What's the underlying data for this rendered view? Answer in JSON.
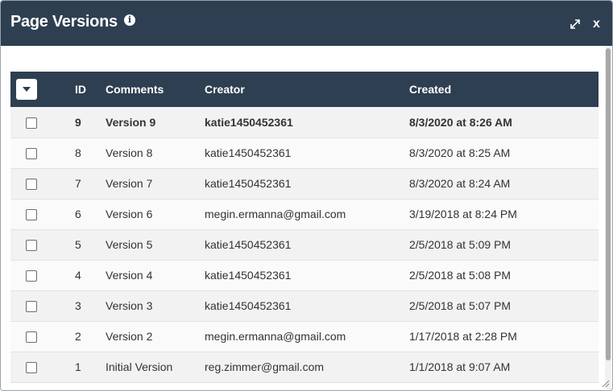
{
  "dialog": {
    "title": "Page Versions",
    "info_icon": "info-icon",
    "expand_icon": "expand-icon",
    "close_label": "x"
  },
  "colors": {
    "header_bg": "#2e3f51",
    "row_odd": "#f2f2f2",
    "row_even": "#fafafa",
    "text": "#333333"
  },
  "table": {
    "headers": {
      "id": "ID",
      "comments": "Comments",
      "creator": "Creator",
      "created": "Created"
    },
    "rows": [
      {
        "id": "9",
        "comments": "Version 9",
        "creator": "katie1450452361",
        "created": "8/3/2020 at 8:26 AM",
        "current": true
      },
      {
        "id": "8",
        "comments": "Version 8",
        "creator": "katie1450452361",
        "created": "8/3/2020 at 8:25 AM",
        "current": false
      },
      {
        "id": "7",
        "comments": "Version 7",
        "creator": "katie1450452361",
        "created": "8/3/2020 at 8:24 AM",
        "current": false
      },
      {
        "id": "6",
        "comments": "Version 6",
        "creator": "megin.ermanna@gmail.com",
        "created": "3/19/2018 at 8:24 PM",
        "current": false
      },
      {
        "id": "5",
        "comments": "Version 5",
        "creator": "katie1450452361",
        "created": "2/5/2018 at 5:09 PM",
        "current": false
      },
      {
        "id": "4",
        "comments": "Version 4",
        "creator": "katie1450452361",
        "created": "2/5/2018 at 5:08 PM",
        "current": false
      },
      {
        "id": "3",
        "comments": "Version 3",
        "creator": "katie1450452361",
        "created": "2/5/2018 at 5:07 PM",
        "current": false
      },
      {
        "id": "2",
        "comments": "Version 2",
        "creator": "megin.ermanna@gmail.com",
        "created": "1/17/2018 at 2:28 PM",
        "current": false
      },
      {
        "id": "1",
        "comments": "Initial Version",
        "creator": "reg.zimmer@gmail.com",
        "created": "1/1/2018 at 9:07 AM",
        "current": false
      }
    ]
  }
}
